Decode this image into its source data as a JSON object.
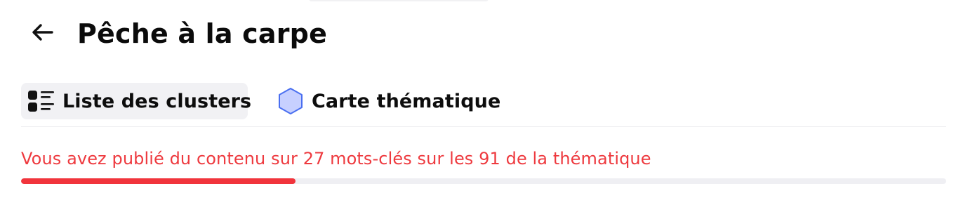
{
  "header": {
    "title": "Pêche à la carpe",
    "back_icon": "arrow-left-icon"
  },
  "tabs": [
    {
      "label": "Liste des clusters",
      "icon": "cluster-list-icon",
      "active": true
    },
    {
      "label": "Carte thématique",
      "icon": "hexagon-icon",
      "active": false,
      "icon_color": "#c7d0ff",
      "icon_stroke": "#4a6ff0"
    }
  ],
  "progress": {
    "text": "Vous avez publié du contenu sur 27 mots-clés sur les 91 de la thématique",
    "published": 27,
    "total": 91,
    "color": "#f1343c",
    "text_color": "#ee3a3f"
  }
}
